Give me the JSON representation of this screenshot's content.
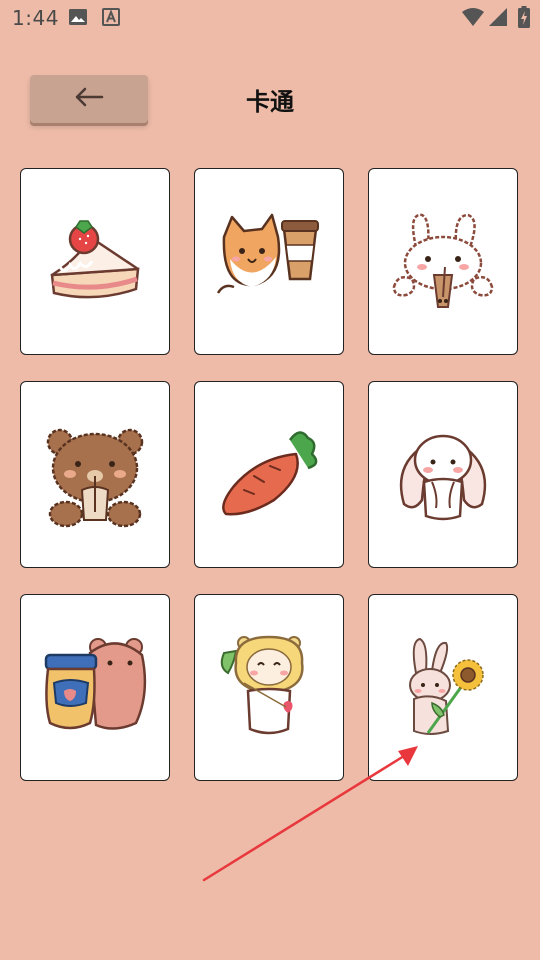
{
  "status_bar": {
    "time": "1:44",
    "icons": [
      "image-icon",
      "text-a-icon",
      "wifi-icon",
      "signal-icon",
      "battery-charging-icon"
    ]
  },
  "header": {
    "back_icon": "arrow-left-icon",
    "title": "卡通"
  },
  "stickers": [
    {
      "name": "strawberry-cake",
      "icon": "strawberry-cake-icon"
    },
    {
      "name": "shiba-coffee",
      "icon": "shiba-dog-coffee-icon"
    },
    {
      "name": "bunny-bubble-tea",
      "icon": "bunny-bubble-tea-icon"
    },
    {
      "name": "bear-drink",
      "icon": "brown-bear-icon"
    },
    {
      "name": "carrot",
      "icon": "carrot-icon"
    },
    {
      "name": "lop-bunny",
      "icon": "lop-ear-bunny-icon"
    },
    {
      "name": "bear-honey-jar",
      "icon": "bear-honey-jar-icon"
    },
    {
      "name": "bear-flower-hood",
      "icon": "bear-flower-hood-icon"
    },
    {
      "name": "bunny-sunflower",
      "icon": "bunny-sunflower-icon"
    }
  ],
  "colors": {
    "background": "#EDBBA7",
    "back_button": "#C9A391",
    "annotation_arrow": "#E8383D"
  }
}
